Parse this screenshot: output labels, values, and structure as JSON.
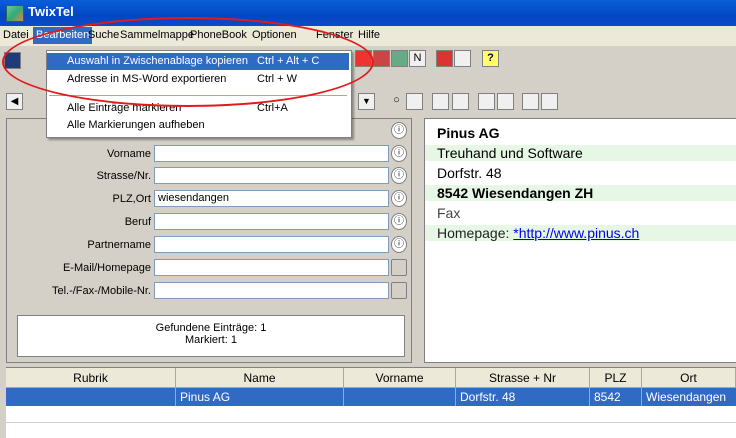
{
  "window": {
    "title": "TwixTel"
  },
  "menubar": {
    "items": [
      "Datei",
      "Bearbeiten",
      "Suche",
      "Sammelmappe",
      "PhoneBook",
      "Optionen",
      "Fenster",
      "Hilfe"
    ]
  },
  "dropdown": {
    "items": [
      {
        "label": "Auswahl in Zwischenablage kopieren",
        "shortcut": "Ctrl + Alt + C"
      },
      {
        "label": "Adresse in MS-Word exportieren",
        "shortcut": "Ctrl + W"
      },
      {
        "label": "Alle Einträge markieren",
        "shortcut": "Ctrl+A"
      },
      {
        "label": "Alle Markierungen aufheben",
        "shortcut": ""
      }
    ]
  },
  "toolbar": {
    "help": "?",
    "n_button": "N"
  },
  "form": {
    "fields": [
      {
        "label": "Vorname",
        "value": ""
      },
      {
        "label": "Strasse/Nr.",
        "value": ""
      },
      {
        "label": "PLZ,Ort",
        "value": "wiesendangen"
      },
      {
        "label": "Beruf",
        "value": ""
      },
      {
        "label": "Partnername",
        "value": ""
      },
      {
        "label": "E-Mail/Homepage",
        "value": ""
      },
      {
        "label": "Tel.-/Fax-/Mobile-Nr.",
        "value": ""
      }
    ],
    "info_symbol": "ⓘ",
    "status_found": "Gefundene Einträge: 1",
    "status_marked": "Markiert: 1"
  },
  "detail": {
    "name": "Pinus AG",
    "business": "Treuhand und Software",
    "street": "Dorfstr. 48",
    "city": "8542 Wiesendangen ZH",
    "fax": "Fax",
    "homepage_label": "Homepage: ",
    "homepage_link": "*http://www.pinus.ch"
  },
  "table": {
    "columns": [
      "Rubrik",
      "Name",
      "Vorname",
      "Strasse + Nr",
      "PLZ",
      "Ort"
    ],
    "rows": [
      [
        "",
        "Pinus AG",
        "",
        "Dorfstr. 48",
        "8542",
        "Wiesendangen"
      ]
    ]
  },
  "colors": {
    "selection": "#316ac5",
    "highlight_ring": "#e01b1b",
    "link": "#0000ee"
  }
}
